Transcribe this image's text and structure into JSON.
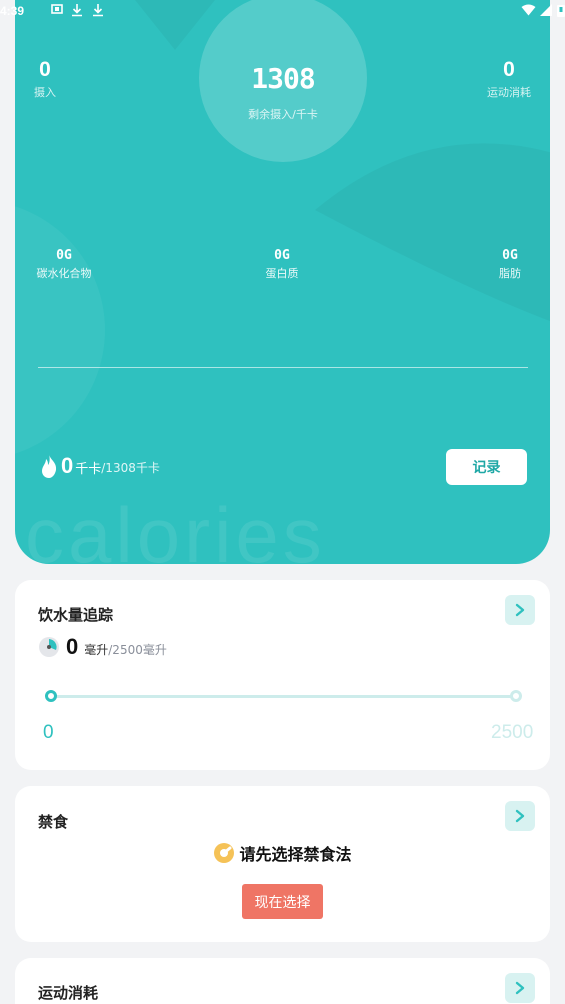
{
  "status_bar": {
    "time": "4:39"
  },
  "summary": {
    "intake_value": "0",
    "intake_label": "摄入",
    "remaining_value": "1308",
    "remaining_label": "剩余摄入/千卡",
    "exercise_value": "0",
    "exercise_label": "运动消耗"
  },
  "macros": [
    {
      "value": "0G",
      "label": "碳水化合物"
    },
    {
      "value": "0G",
      "label": "蛋白质"
    },
    {
      "value": "0G",
      "label": "脂肪"
    }
  ],
  "calories": {
    "consumed": "0",
    "unit": "千卡",
    "goal": "/1308千卡",
    "record_button": "记录",
    "watermark": "calories"
  },
  "water": {
    "title": "饮水量追踪",
    "amount": "0",
    "unit": "毫升",
    "goal": "/2500毫升",
    "progress_fraction": 0,
    "slider_min": "0",
    "slider_max": "2500"
  },
  "fasting": {
    "title": "禁食",
    "message": "请先选择禁食法",
    "choose_button": "现在选择"
  },
  "exercise_card": {
    "title": "运动消耗"
  },
  "colors": {
    "accent": "#2fc1bf",
    "accent_light": "#d8f2f1",
    "cta": "#ef7565"
  }
}
